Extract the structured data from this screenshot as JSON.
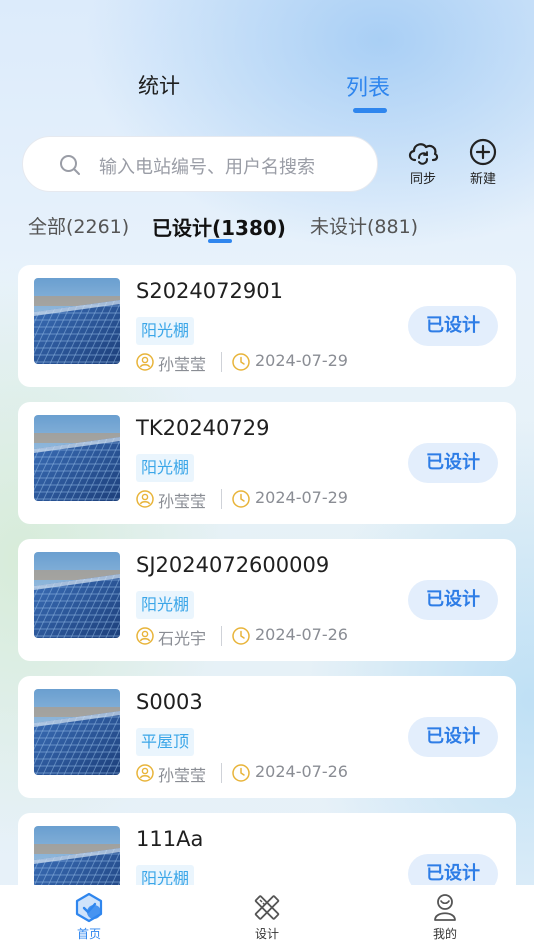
{
  "top_tabs": {
    "stats_label": "统计",
    "list_label": "列表"
  },
  "search": {
    "placeholder": "输入电站编号、用户名搜索"
  },
  "toolbar": {
    "sync_label": "同步",
    "add_label": "新建"
  },
  "filters": {
    "all": "全部(2261)",
    "designed": "已设计(1380)",
    "undesigned": "未设计(881)"
  },
  "cards": [
    {
      "title": "S2024072901",
      "tag": "阳光棚",
      "user": "孙莹莹",
      "date": "2024-07-29",
      "status": "已设计"
    },
    {
      "title": "TK20240729",
      "tag": "阳光棚",
      "user": "孙莹莹",
      "date": "2024-07-29",
      "status": "已设计"
    },
    {
      "title": "SJ2024072600009",
      "tag": "阳光棚",
      "user": "石光宇",
      "date": "2024-07-26",
      "status": "已设计"
    },
    {
      "title": "S0003",
      "tag": "平屋顶",
      "user": "孙莹莹",
      "date": "2024-07-26",
      "status": "已设计"
    },
    {
      "title": "111Aa",
      "tag": "阳光棚",
      "user": "",
      "date": "",
      "status": "已设计"
    }
  ],
  "bottom_nav": {
    "home": "首页",
    "design": "设计",
    "mine": "我的"
  },
  "colors": {
    "accent": "#2f86ee",
    "tag_text": "#3ba6e8",
    "status_bg": "#e3eefc"
  }
}
